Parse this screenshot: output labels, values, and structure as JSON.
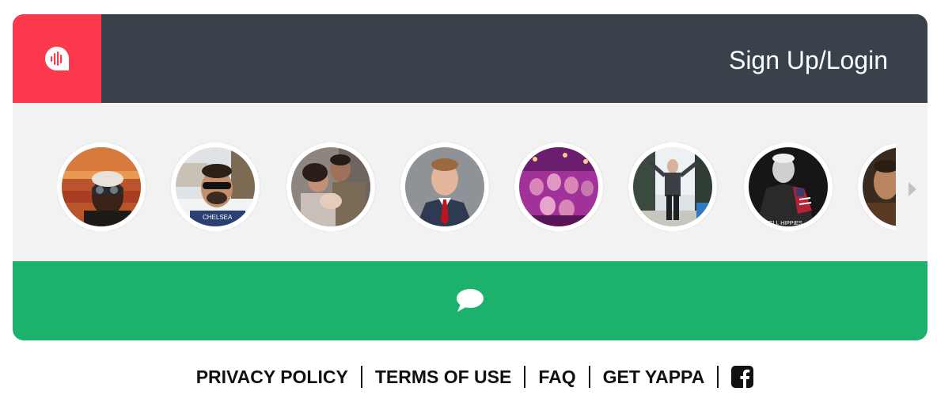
{
  "header": {
    "logo_icon": "yappa-audio-bubble-icon",
    "login_label": "Sign Up/Login",
    "colors": {
      "logo_bg": "#fd3a4d",
      "header_bg": "#39424a"
    }
  },
  "avatars": {
    "count_visible": 8,
    "next_icon": "chevron-right-icon",
    "strip_bg": "#f2f2f3",
    "caption_2": "CHELSEA",
    "caption_7": "OWELL HIPPIES"
  },
  "chat_bar": {
    "icon": "chat-bubble-icon",
    "color": "#1db16e"
  },
  "footer": {
    "links": [
      "PRIVACY POLICY",
      "TERMS OF USE",
      "FAQ",
      "GET YAPPA"
    ],
    "social_icon": "facebook-icon"
  }
}
